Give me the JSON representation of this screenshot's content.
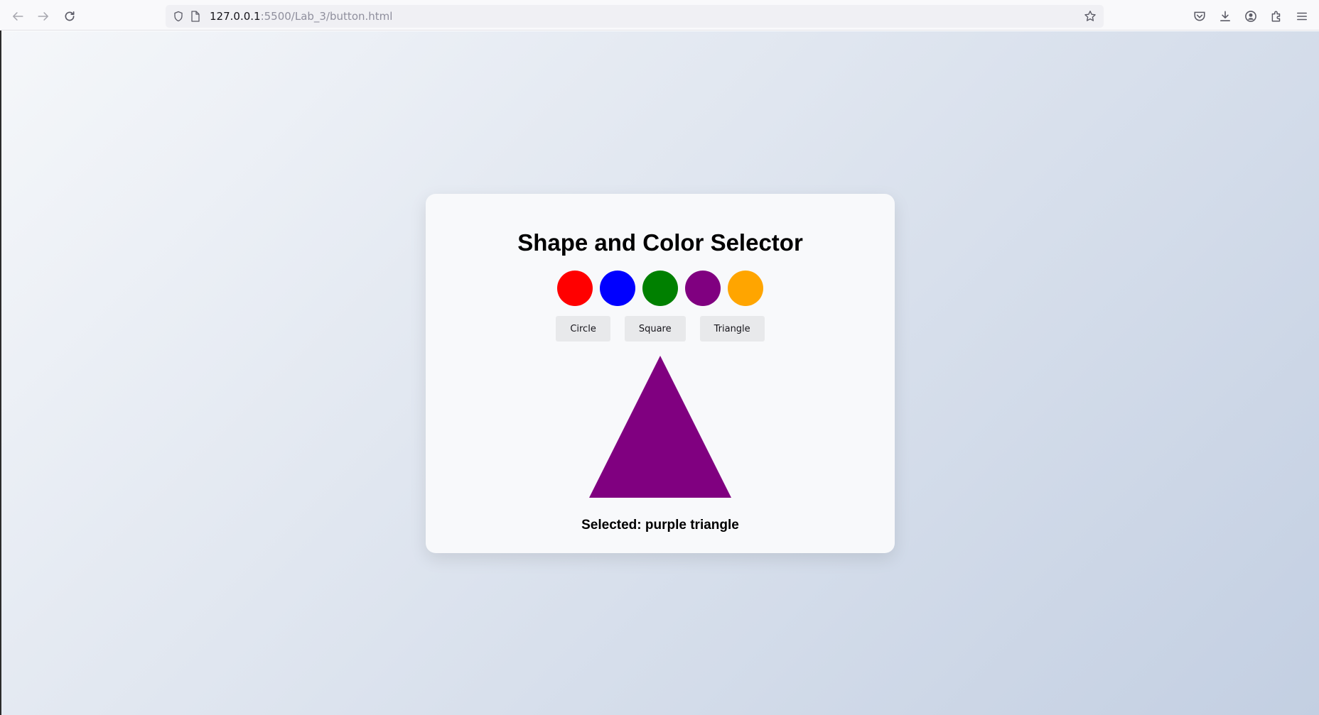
{
  "browser": {
    "url_host": "127.0.0.1",
    "url_path": ":5500/Lab_3/button.html"
  },
  "page": {
    "title": "Shape and Color Selector",
    "swatches": [
      {
        "name": "red",
        "color": "#ff0000"
      },
      {
        "name": "blue",
        "color": "#0000ff"
      },
      {
        "name": "green",
        "color": "#008000"
      },
      {
        "name": "purple",
        "color": "#800080"
      },
      {
        "name": "orange",
        "color": "#ffa500"
      }
    ],
    "shape_buttons": [
      "Circle",
      "Square",
      "Triangle"
    ],
    "selected_shape": "triangle",
    "selected_color": "#800080",
    "selected_text": "Selected: purple triangle"
  }
}
